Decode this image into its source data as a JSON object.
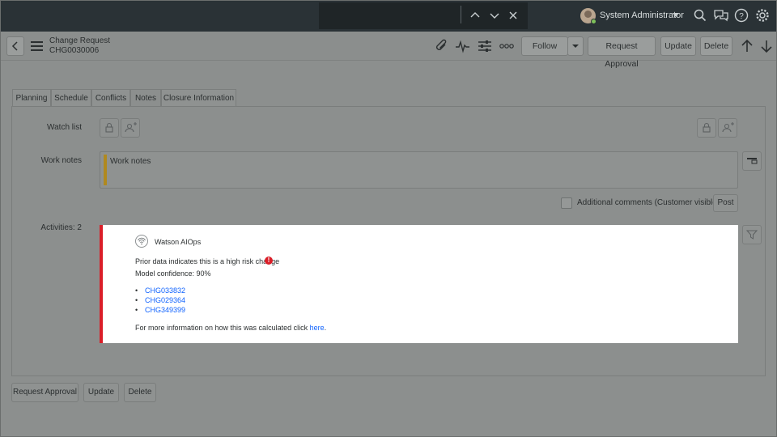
{
  "banner": {
    "user_name": "System Administrator",
    "icons": [
      "chevron-up-icon",
      "chevron-down-icon",
      "close-icon",
      "search-icon",
      "chat-icon",
      "help-icon",
      "gear-icon"
    ]
  },
  "form_header": {
    "record_type": "Change Request",
    "record_number": "CHG0030006",
    "follow_label": "Follow",
    "request_approval_label": "Request Approval",
    "update_label": "Update",
    "delete_label": "Delete"
  },
  "tabs": [
    {
      "label": "Planning"
    },
    {
      "label": "Schedule"
    },
    {
      "label": "Conflicts"
    },
    {
      "label": "Notes"
    },
    {
      "label": "Closure Information"
    }
  ],
  "notes": {
    "watch_list_label": "Watch list",
    "work_notes_label": "Work notes",
    "work_notes_placeholder": "Work notes",
    "additional_comments_label": "Additional comments (Customer visible)",
    "post_label": "Post",
    "activities_label": "Activities: 2"
  },
  "aiops_card": {
    "title": "Watson AIOps",
    "message": "Prior data indicates this is a high risk change",
    "confidence": "Model confidence:  90%",
    "related_changes": [
      "CHG033832",
      "CHG029364",
      "CHG349399"
    ],
    "more_info_prefix": "For more information on how this was calculated click ",
    "more_info_link": "here",
    "more_info_suffix": ".",
    "accent_color": "#da1e28",
    "link_color": "#0f62fe"
  },
  "footer": {
    "request_approval_label": "Request Approval",
    "update_label": "Update",
    "delete_label": "Delete"
  }
}
